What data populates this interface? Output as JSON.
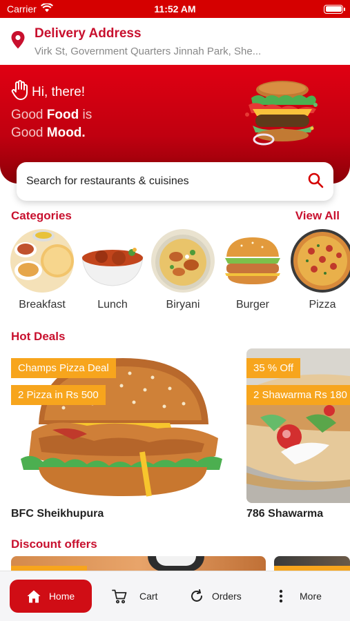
{
  "status_bar": {
    "carrier": "Carrier",
    "time": "11:52 AM",
    "battery_level": 1.0
  },
  "address": {
    "title": "Delivery Address",
    "line": "Virk St, Government Quarters Jinnah Park, She..."
  },
  "hero": {
    "greeting": "Hi, there!",
    "line1_pre": "Good ",
    "line1_bold": "Food",
    "line1_post": " is",
    "line2_pre": "Good ",
    "line2_bold": "Mood."
  },
  "search": {
    "placeholder": "Search for restaurants & cuisines"
  },
  "categories": {
    "title": "Categories",
    "view_all": "View All",
    "items": [
      {
        "label": "Breakfast"
      },
      {
        "label": "Lunch"
      },
      {
        "label": "Biryani"
      },
      {
        "label": "Burger"
      },
      {
        "label": "Pizza"
      }
    ]
  },
  "hot_deals": {
    "title": "Hot Deals",
    "items": [
      {
        "tag1": "Champs Pizza Deal",
        "tag2": "2 Pizza in Rs 500",
        "name": "BFC Sheikhupura"
      },
      {
        "tag1": "35 % Off",
        "tag2": "2 Shawarma Rs 180",
        "name": "786 Shawarma"
      }
    ]
  },
  "discount": {
    "title": "Discount offers"
  },
  "bottom_nav": {
    "home": "Home",
    "cart": "Cart",
    "orders": "Orders",
    "more": "More"
  },
  "colors": {
    "brand_red": "#d50000",
    "accent_orange": "#f7a51d"
  },
  "icons": [
    "wifi-icon",
    "battery-icon",
    "location-pin-icon",
    "hand-wave-icon",
    "search-icon",
    "home-icon",
    "cart-icon",
    "refresh-icon",
    "more-vertical-icon"
  ]
}
